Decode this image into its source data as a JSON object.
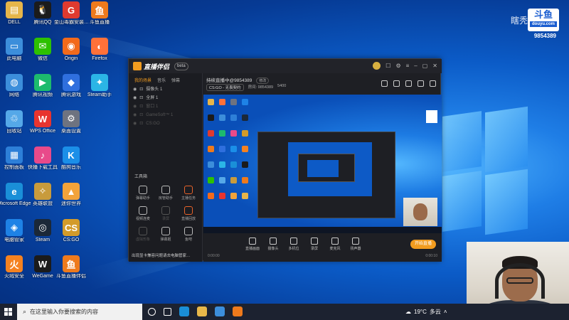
{
  "desktop": {
    "icons": [
      {
        "label": "DELL",
        "color": "#e6b54a",
        "glyph": "▤"
      },
      {
        "label": "腾讯QQ",
        "color": "#1b1b1b",
        "glyph": "🐧"
      },
      {
        "label": "金山毒霸安装…",
        "color": "#e03a2f",
        "glyph": "G"
      },
      {
        "label": "斗鱼直播",
        "color": "#ee7a1c",
        "glyph": "鱼"
      },
      {
        "label": "此电脑",
        "color": "#3c8edb",
        "glyph": "▭"
      },
      {
        "label": "微信",
        "color": "#2dc100",
        "glyph": "✉"
      },
      {
        "label": "Origin",
        "color": "#f26a1b",
        "glyph": "◉"
      },
      {
        "label": "Firefox",
        "color": "#ff7139",
        "glyph": "◐"
      },
      {
        "label": "网络",
        "color": "#3c8edb",
        "glyph": "◍"
      },
      {
        "label": "腾讯视频",
        "color": "#1dbb6d",
        "glyph": "▶"
      },
      {
        "label": "腾讯游戏",
        "color": "#2f6fde",
        "glyph": "◆"
      },
      {
        "label": "Steam助手",
        "color": "#2bb5e6",
        "glyph": "✦"
      },
      {
        "label": "回收站",
        "color": "#55a8e8",
        "glyph": "♲"
      },
      {
        "label": "WPS Office",
        "color": "#e8342f",
        "glyph": "W"
      },
      {
        "label": "桌面设置",
        "color": "#6e7380",
        "glyph": "⚙"
      },
      {
        "label": "控制面板",
        "color": "#2d7fd8",
        "glyph": "▦"
      },
      {
        "label": "快播下载工具",
        "color": "#e84a8a",
        "glyph": "♪"
      },
      {
        "label": "酷狗音乐",
        "color": "#1b8fe8",
        "glyph": "K"
      },
      {
        "label": "Microsoft Edge",
        "color": "#1a8fd8",
        "glyph": "e"
      },
      {
        "label": "英雄联盟",
        "color": "#c89b3c",
        "glyph": "✧"
      },
      {
        "label": "迷你世界",
        "color": "#f2a33a",
        "glyph": "▲"
      },
      {
        "label": "电脑管家",
        "color": "#1e82e6",
        "glyph": "◈"
      },
      {
        "label": "Steam",
        "color": "#1b2838",
        "glyph": "◎"
      },
      {
        "label": "CS:GO",
        "color": "#d39b2a",
        "glyph": "CS"
      },
      {
        "label": "火绒安全",
        "color": "#f58220",
        "glyph": "火"
      },
      {
        "label": "WeGame",
        "color": "#1b1b1b",
        "glyph": "W"
      },
      {
        "label": "斗鱼直播伴侣",
        "color": "#ee7a1c",
        "glyph": "鱼"
      }
    ]
  },
  "watermark": {
    "name": "瞎秃",
    "logo": "斗鱼",
    "logo_sub": "douyu.com",
    "room_id": "9854389"
  },
  "app": {
    "name": "直播伴侣",
    "badge": "beta",
    "sidebar_tabs": [
      "我的场景",
      "音乐",
      "弹幕"
    ],
    "sources": [
      {
        "label": "摄像头 1",
        "dim": false
      },
      {
        "label": "全屏 1",
        "dim": false
      },
      {
        "label": "窗口 1",
        "dim": true
      },
      {
        "label": "GameSoft™ 1",
        "dim": true
      },
      {
        "label": "CS:GO",
        "dim": true
      }
    ],
    "tools_title": "工具箱",
    "tools": [
      {
        "label": "弹幕助手",
        "dim": false,
        "accent": false
      },
      {
        "label": "房管助手",
        "dim": false,
        "accent": false
      },
      {
        "label": "主播任务",
        "dim": false,
        "accent": true
      },
      {
        "label": "视频连麦",
        "dim": false,
        "accent": false
      },
      {
        "label": "录屏",
        "dim": true,
        "accent": false
      },
      {
        "label": "直播回放",
        "dim": false,
        "accent": true
      },
      {
        "label": "虚拟形象",
        "dim": true,
        "accent": false
      },
      {
        "label": "弹幕姬",
        "dim": false,
        "accent": false
      },
      {
        "label": "鱼吧",
        "dim": false,
        "accent": false
      }
    ],
    "banner": "出现显卡兼容问题请去电脑管家…",
    "room_title": "持续直播中@9854389",
    "edit_label": "修改",
    "category": "CS:GO - 无畏契约",
    "room_id_label": "房间: 9854389",
    "heat": "5400",
    "bottom_tools": [
      "直播画面",
      "摄像头",
      "多机位",
      "录屏",
      "麦克风",
      "扬声器"
    ],
    "go_live": "开始直播",
    "status_left": "0:00:00",
    "status_right": "0:00:10"
  },
  "taskbar": {
    "search_placeholder": "在这里输入你要搜索的内容",
    "temperature": "19°C",
    "weather": "多云",
    "icon_colors": [
      "#ffffff",
      "#ffffff",
      "#1a8fd8",
      "#e8b84a",
      "#3c8edb",
      "#ee7a1c"
    ]
  }
}
